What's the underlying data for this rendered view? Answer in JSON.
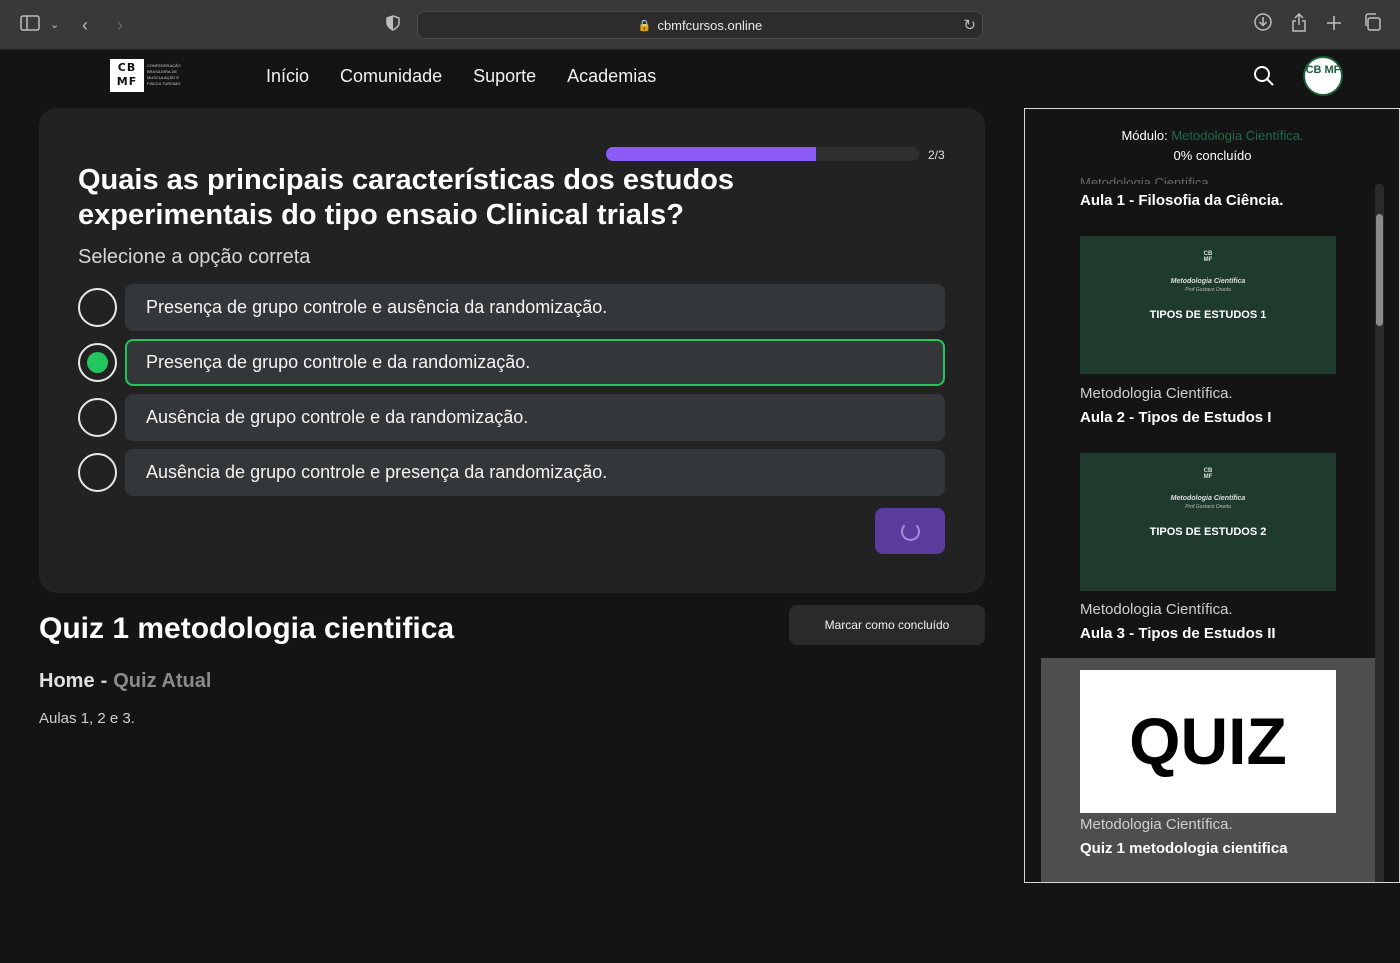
{
  "browser": {
    "url": "cbmfcursos.online"
  },
  "nav": {
    "logo_mark": "CB MF",
    "logo_text": "CONFEDERAÇÃO BRASILEIRA DE MUSCULAÇÃO E FISICULTURISMO",
    "links": [
      "Início",
      "Comunidade",
      "Suporte",
      "Academias"
    ],
    "avatar_text": "CB MF"
  },
  "quiz": {
    "progress_label": "2/3",
    "progress_fraction": 0.67,
    "question": "Quais as principais características dos estudos experimentais do tipo ensaio Clinical trials?",
    "instruction": "Selecione a opção correta",
    "options": [
      "Presença de grupo controle e ausência da randomização.",
      "Presença de grupo controle e da randomização.",
      "Ausência de grupo controle e da randomização.",
      "Ausência de grupo controle e presença da randomização."
    ],
    "selected_index": 1
  },
  "page": {
    "title": "Quiz 1 metodologia cientifica",
    "mark_complete": "Marcar como concluído",
    "breadcrumb_home": "Home",
    "breadcrumb_sep": "-",
    "breadcrumb_current": "Quiz Atual",
    "description": "Aulas 1, 2 e 3."
  },
  "sidebar": {
    "module_label": "Módulo:",
    "module_name": "Metodologia Científica.",
    "progress_text": "0% concluído",
    "lessons": [
      {
        "subtitle": "Metodologia Científica.",
        "title": "Aula 1 - Filosofia da Ciência."
      },
      {
        "subtitle": "Metodologia Científica.",
        "title": "Aula 2 - Tipos de Estudos I",
        "thumb_course": "Metodologia Científica",
        "thumb_prof": "Prof Gustavo Oneda",
        "thumb_label": "TIPOS DE ESTUDOS 1"
      },
      {
        "subtitle": "Metodologia Científica.",
        "title": "Aula 3 - Tipos de Estudos II",
        "thumb_course": "Metodologia Científica",
        "thumb_prof": "Prof Gustavo Oneda",
        "thumb_label": "TIPOS DE ESTUDOS 2"
      },
      {
        "subtitle": "Metodologia Científica.",
        "title": "Quiz 1 metodologia cientifica",
        "thumb_label": "QUIZ"
      }
    ]
  },
  "colors": {
    "accent_purple": "#8b5cf6",
    "selected_green": "#22c55e",
    "brand_green": "#1f6b44"
  }
}
